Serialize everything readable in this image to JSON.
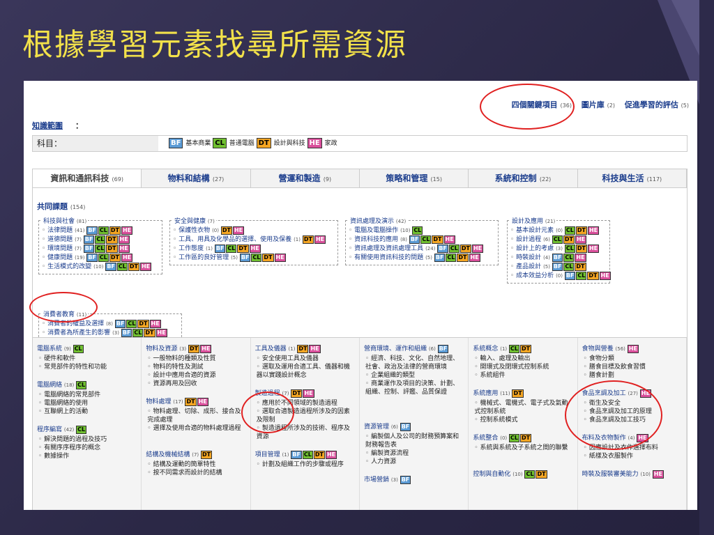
{
  "title": "根據學習元素找尋所需資源",
  "top_links": {
    "four_key": "四個關鍵項目",
    "four_key_count": "(36)",
    "image_bank": "圖片庫",
    "image_bank_count": "(2)",
    "assessment": "促進學習的評估",
    "assessment_count": "(5)"
  },
  "scope_label": "知識範圍",
  "scope_colon": "：",
  "subject_label": "科目：",
  "legend": [
    {
      "tag": "BF",
      "label": "基本商業"
    },
    {
      "tag": "CL",
      "label": "普通電腦"
    },
    {
      "tag": "DT",
      "label": "設計與科技"
    },
    {
      "tag": "HE",
      "label": "家政"
    }
  ],
  "tabs": [
    {
      "label": "資訊和通訊科技",
      "count": "(69)"
    },
    {
      "label": "物料和結構",
      "count": "(27)"
    },
    {
      "label": "營運和製造",
      "count": "(9)"
    },
    {
      "label": "策略和管理",
      "count": "(15)"
    },
    {
      "label": "系統和控制",
      "count": "(22)"
    },
    {
      "label": "科技與生活",
      "count": "(117)"
    }
  ],
  "common": {
    "title": "共同課題",
    "count": "(154)"
  },
  "groups": [
    {
      "title": "科技與社會",
      "count": "(81)",
      "items": [
        {
          "t": "法律問題",
          "c": "(41)",
          "tags": [
            "BF",
            "CL",
            "DT",
            "HE"
          ]
        },
        {
          "t": "道德問題",
          "c": "(7)",
          "tags": [
            "BF",
            "CL",
            "DT",
            "HE"
          ]
        },
        {
          "t": "環境問題",
          "c": "(7)",
          "tags": [
            "BF",
            "CL",
            "DT",
            "HE"
          ]
        },
        {
          "t": "健康問題",
          "c": "(19)",
          "tags": [
            "BF",
            "CL",
            "DT",
            "HE"
          ]
        },
        {
          "t": "生活模式的改變",
          "c": "(10)",
          "tags": [
            "BF",
            "CL",
            "DT",
            "HE"
          ]
        }
      ]
    },
    {
      "title": "安全與健康",
      "count": "(7)",
      "items": [
        {
          "t": "保護性衣物",
          "c": "(0)",
          "tags": [
            "DT",
            "HE"
          ]
        },
        {
          "t": "工具、用具及化學品的選擇、使用及保養",
          "c": "(1)",
          "tags": [
            "DT",
            "HE"
          ]
        },
        {
          "t": "工作態度",
          "c": "(1)",
          "tags": [
            "BF",
            "CL",
            "DT",
            "HE"
          ]
        },
        {
          "t": "工作區的良好管理",
          "c": "(5)",
          "tags": [
            "BF",
            "CL",
            "DT",
            "HE"
          ]
        }
      ]
    },
    {
      "title": "資訊處理及演示",
      "count": "(42)",
      "items": [
        {
          "t": "電腦及電腦操作",
          "c": "(10)",
          "tags": [
            "CL"
          ]
        },
        {
          "t": "資訊科技的應用",
          "c": "(8)",
          "tags": [
            "BF",
            "CL",
            "DT",
            "HE"
          ]
        },
        {
          "t": "資訊處理及資訊處理工具",
          "c": "(24)",
          "tags": [
            "BF",
            "CL",
            "DT",
            "HE"
          ]
        },
        {
          "t": "有關使用資訊科技的問題",
          "c": "(5)",
          "tags": [
            "BF",
            "CL",
            "DT",
            "HE"
          ]
        }
      ]
    },
    {
      "title": "設計及應用",
      "count": "(21)",
      "items": [
        {
          "t": "基本設計元素",
          "c": "(0)",
          "tags": [
            "CL",
            "DT",
            "HE"
          ]
        },
        {
          "t": "設計過程",
          "c": "(6)",
          "tags": [
            "CL",
            "DT",
            "HE"
          ]
        },
        {
          "t": "設計上的考慮",
          "c": "(3)",
          "tags": [
            "CL",
            "DT",
            "HE"
          ]
        },
        {
          "t": "時裝設計",
          "c": "(4)",
          "tags": [
            "BF",
            "CL",
            "HE"
          ]
        },
        {
          "t": "產品設計",
          "c": "(5)",
          "tags": [
            "BF",
            "CL",
            "DT"
          ]
        },
        {
          "t": "成本效益分析",
          "c": "(0)",
          "tags": [
            "BF",
            "CL",
            "DT",
            "HE"
          ]
        }
      ]
    },
    {
      "title": "消費者教育",
      "count": "(11)",
      "items": [
        {
          "t": "消費者的權益及選擇",
          "c": "(8)",
          "tags": [
            "BF",
            "CL",
            "DT",
            "HE"
          ]
        },
        {
          "t": "消費者為所產生的影響",
          "c": "(3)",
          "tags": [
            "BF",
            "CL",
            "DT",
            "HE"
          ]
        }
      ]
    }
  ],
  "bottom_cols": [
    [
      {
        "h": "電腦系統",
        "c": "(9)",
        "tags": [
          "CL"
        ],
        "items": [
          "硬件和軟件",
          "常見部件的特性和功能"
        ]
      },
      {
        "h": "電腦網絡",
        "c": "(18)",
        "tags": [
          "CL"
        ],
        "items": [
          "電腦網絡的常見部件",
          "電腦網絡的使用",
          "互聯網上的活動"
        ]
      },
      {
        "h": "程序編寫",
        "c": "(42)",
        "tags": [
          "CL"
        ],
        "items": [
          "解決問題的過程及技巧",
          "有關序序程序的概念",
          "數據操作"
        ]
      }
    ],
    [
      {
        "h": "物料及資源",
        "c": "(3)",
        "tags": [
          "DT",
          "HE"
        ],
        "items": [
          "一般物料的種類及性質",
          "物料的特性及測試",
          "設計中應用合適的資源",
          "資源再用及回收"
        ]
      },
      {
        "h": "物料處理",
        "c": "(17)",
        "tags": [
          "DT",
          "HE"
        ],
        "items": [
          "物料處理、切除、成形、接合及完成處理",
          "選擇及使用合適的物料處理過程"
        ]
      },
      {
        "h": "結構及機械結構",
        "c": "(7)",
        "tags": [
          "DT"
        ],
        "items": [
          "結構及運動的簡單特性",
          "按不同需求而設計的結構"
        ]
      }
    ],
    [
      {
        "h": "工具及儀器",
        "c": "(1)",
        "tags": [
          "DT",
          "HE"
        ],
        "items": [
          "安全使用工具及儀器",
          "選取及運用合適工具、儀器和機器以實踐設計概念"
        ]
      },
      {
        "h": "製造過程",
        "c": "(7)",
        "tags": [
          "DT",
          "HE"
        ],
        "items": [
          "應用於不同領域的製造過程",
          "選取合適製造過程所涉及的因素及限制",
          "製造過程所涉及的技術、程序及資源"
        ]
      },
      {
        "h": "項目管理",
        "c": "(1)",
        "tags": [
          "BF",
          "CL",
          "DT",
          "HE"
        ],
        "items": [
          "計劃及組織工作的步驟或程序"
        ]
      }
    ],
    [
      {
        "h": "營商環境、運作和組織",
        "c": "(6)",
        "tags": [
          "BF"
        ],
        "items": [
          "經濟、科技、文化、自然地理、社會、政治及法律的營商環境",
          "企業組織的類型",
          "商業運作及項目的決策、計劃、組織、控制、評鑑、品質保證"
        ]
      },
      {
        "h": "資源管理",
        "c": "(6)",
        "tags": [
          "BF"
        ],
        "items": [
          "編製個人及公司的財務預算案和財務報告表",
          "編製資源流程",
          "人力資源"
        ]
      },
      {
        "h": "市場營銷",
        "c": "(3)",
        "tags": [
          "BF"
        ],
        "items": []
      }
    ],
    [
      {
        "h": "系統概念",
        "c": "(1)",
        "tags": [
          "CL",
          "DT"
        ],
        "items": [
          "輸入、處理及輸出",
          "開環式及閉環式控制系統",
          "系統組件"
        ]
      },
      {
        "h": "系統應用",
        "c": "(11)",
        "tags": [
          "DT"
        ],
        "items": [
          "機械式、電機式、電子式及氣動式控制系統",
          "控制系統模式"
        ]
      },
      {
        "h": "系統整合",
        "c": "(0)",
        "tags": [
          "CL",
          "DT"
        ],
        "items": [
          "系統與系統及子系統之間的聯繫"
        ]
      },
      {
        "h": "控制與自動化",
        "c": "(10)",
        "tags": [
          "CL",
          "DT"
        ],
        "items": []
      }
    ],
    [
      {
        "h": "食物與營養",
        "c": "(56)",
        "tags": [
          "HE"
        ],
        "items": [
          "食物分類",
          "膳食目標及飲食習慣",
          "膳食計劃"
        ]
      },
      {
        "h": "食品烹調及加工",
        "c": "(27)",
        "tags": [
          "HE"
        ],
        "items": [
          "衛生及安全",
          "食品烹調及加工的原理",
          "食品烹調及加工技巧"
        ]
      },
      {
        "h": "布料及衣物製作",
        "c": "(4)",
        "tags": [
          "HE"
        ],
        "items": [
          "因應設計及衣作選擇布料",
          "紙樣及衣服製作"
        ]
      },
      {
        "h": "時裝及服裝審美能力",
        "c": "(10)",
        "tags": [
          "HE"
        ],
        "items": []
      }
    ]
  ]
}
